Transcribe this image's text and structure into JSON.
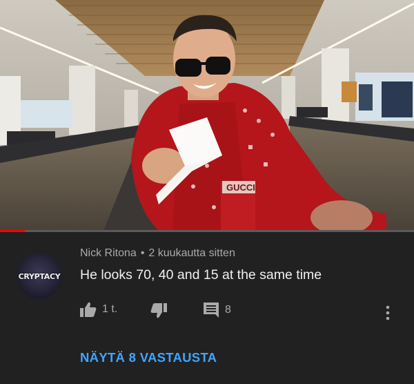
{
  "video": {
    "scene": "airport moving walkway",
    "print_text": "GUCCI",
    "progress_fraction": 0.06
  },
  "comment": {
    "avatar_text": "CRYPTACY",
    "author": "Nick Ritona",
    "separator": "•",
    "time": "2 kuukautta sitten",
    "text": "He looks 70, 40 and 15 at the same time",
    "like_count": "1 t.",
    "reply_count": "8",
    "view_replies": "NÄYTÄ 8 VASTAUSTA"
  },
  "colors": {
    "background": "#212121",
    "link": "#3ea6ff",
    "progress": "#ff0000",
    "secondary_text": "#aaaaaa"
  },
  "icons": [
    "thumbs-up-icon",
    "thumbs-down-icon",
    "comment-icon",
    "more-vert-icon"
  ]
}
